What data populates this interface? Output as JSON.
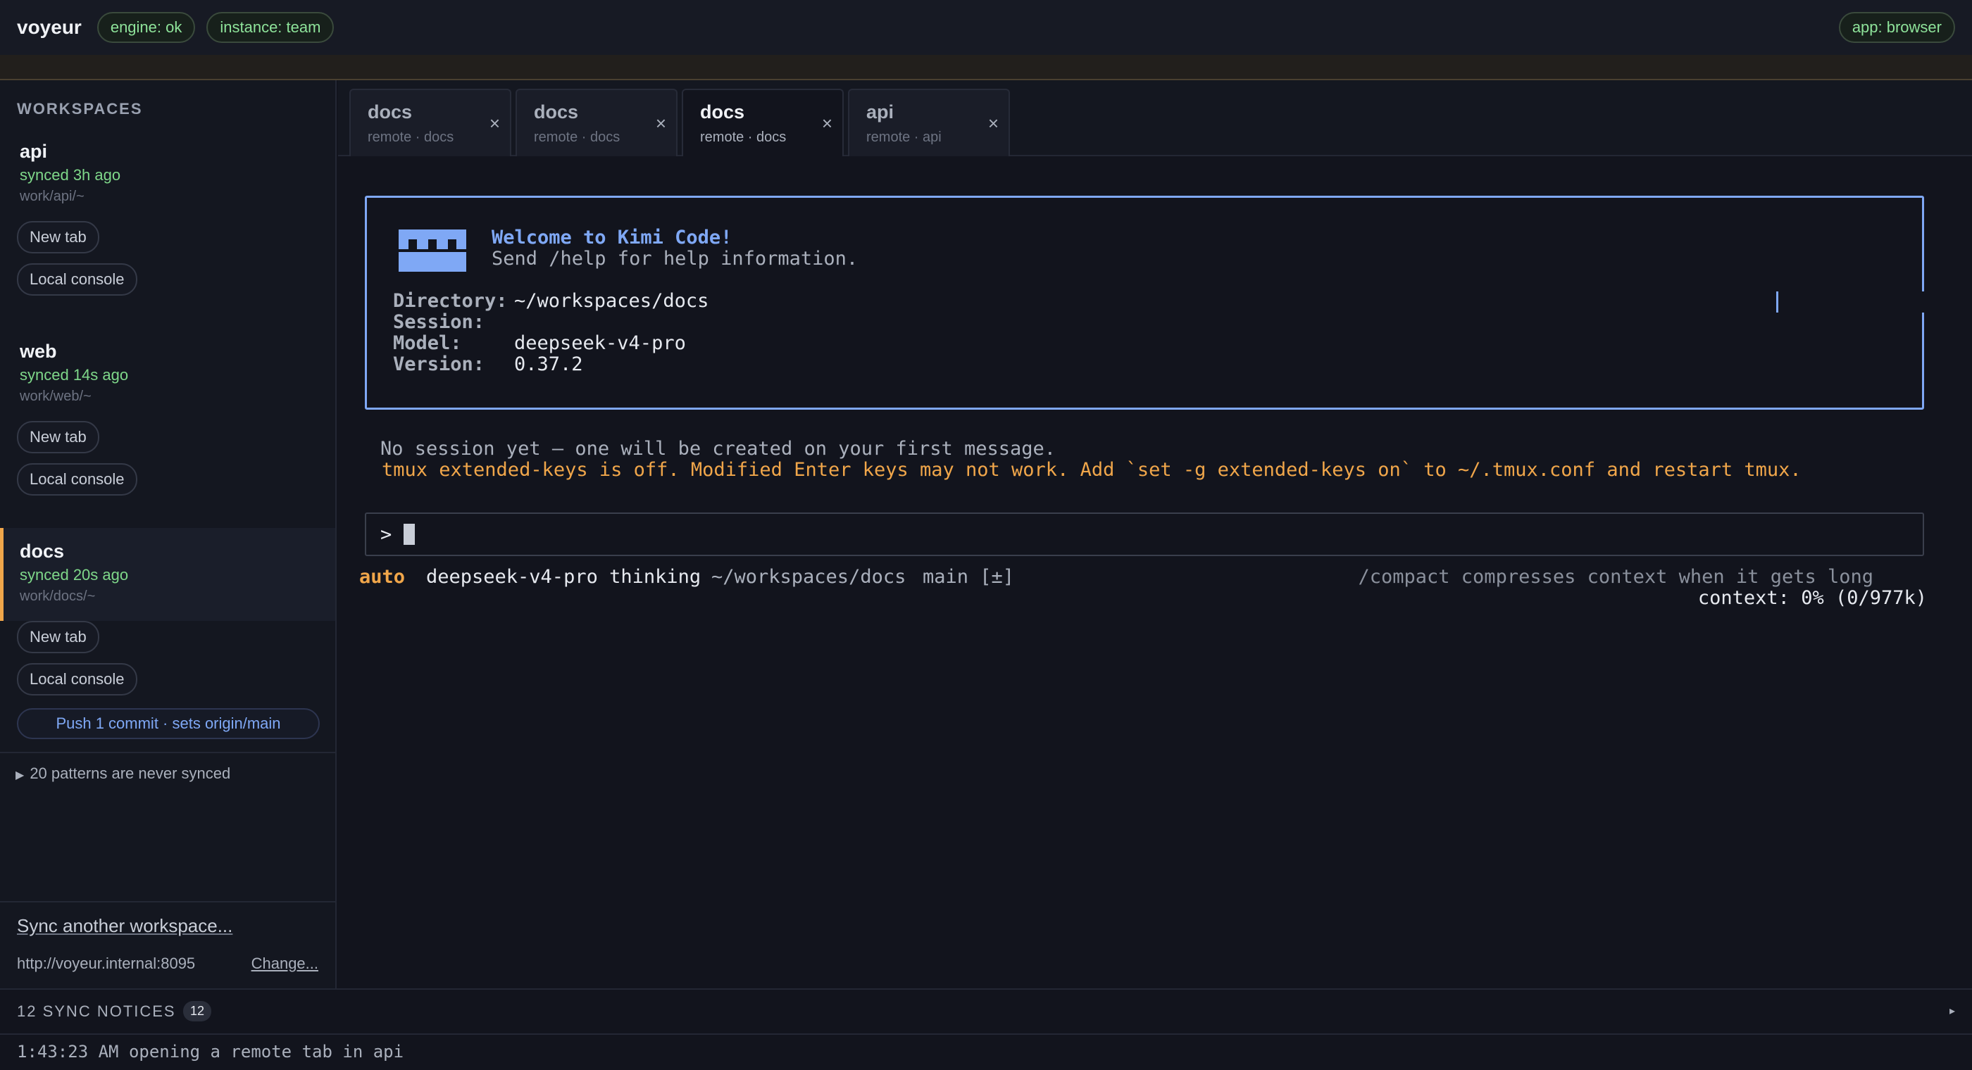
{
  "topbar": {
    "brand": "voyeur",
    "pills": [
      "engine: ok",
      "instance: team"
    ],
    "app_pill": "app: browser"
  },
  "sidebar": {
    "title": "WORKSPACES",
    "workspaces": [
      {
        "name": "api",
        "sync": "synced 3h ago",
        "path": "work/api/~",
        "new_tab": "New tab",
        "local_console": "Local console"
      },
      {
        "name": "web",
        "sync": "synced 14s ago",
        "path": "work/web/~",
        "new_tab": "New tab",
        "local_console": "Local console"
      },
      {
        "name": "docs",
        "sync": "synced 20s ago",
        "path": "work/docs/~",
        "new_tab": "New tab",
        "local_console": "Local console",
        "push": "Push 1 commit · sets origin/main"
      }
    ],
    "patterns": "20 patterns are never synced",
    "sync_another": "Sync another workspace...",
    "server_url": "http://voyeur.internal:8095",
    "change": "Change..."
  },
  "tabs": [
    {
      "title": "docs",
      "sub": "remote · docs",
      "close": "×"
    },
    {
      "title": "docs",
      "sub": "remote · docs",
      "close": "×"
    },
    {
      "title": "docs",
      "sub": "remote · docs",
      "close": "×"
    },
    {
      "title": "api",
      "sub": "remote · api",
      "close": "×"
    }
  ],
  "terminal": {
    "welcome_title": "Welcome to Kimi Code!",
    "welcome_sub": "Send /help for help information.",
    "directory_label": "Directory:",
    "directory_value": "~/workspaces/docs",
    "session_label": "Session:",
    "model_label": "Model:",
    "model_value": "deepseek-v4-pro",
    "version_label": "Version:",
    "version_value": "0.37.2",
    "no_session": "No session yet — one will be created on your first message.",
    "tmux_warning": "tmux extended-keys is off. Modified Enter keys may not work. Add `set -g extended-keys on` to ~/.tmux.conf and restart tmux.",
    "prompt": ">",
    "status_mode": "auto",
    "status_model": "deepseek-v4-pro thinking",
    "status_dir": "~/workspaces/docs",
    "status_branch": "main [±]",
    "status_hint": "/compact compresses context when it gets long",
    "status_context": "context: 0% (0/977k)"
  },
  "notices": {
    "title": "12 SYNC NOTICES",
    "count": "12",
    "toggle": "▸",
    "latest": "1:43:23 AM opening a remote tab in api"
  },
  "colors": {
    "accent_blue": "#7fa8f5",
    "warning_orange": "#f0a64a",
    "sync_green": "#7fd88a"
  }
}
